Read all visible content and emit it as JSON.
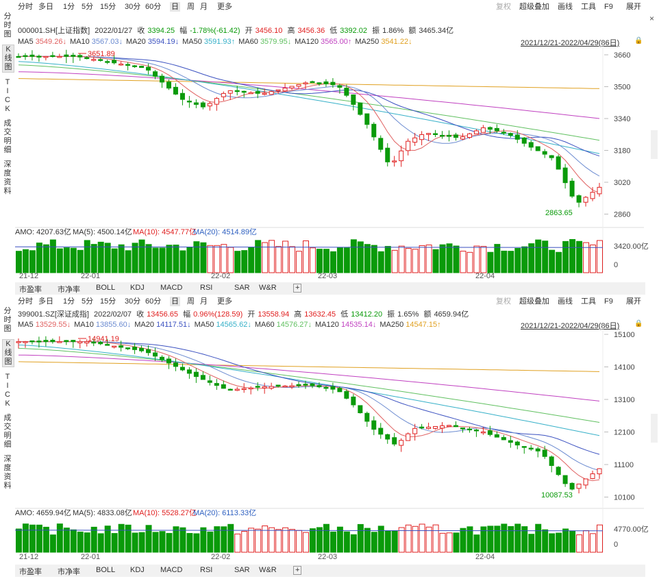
{
  "toolbar": {
    "periods": [
      "分时",
      "多日",
      "1分",
      "5分",
      "15分",
      "30分",
      "60分",
      "日",
      "周",
      "月",
      "更多"
    ],
    "active_period": "日",
    "right_items": [
      "复权",
      "超级叠加",
      "画线",
      "工具",
      "F9",
      "展开"
    ]
  },
  "side_tabs": [
    "分\n时\n图",
    "K\n线\n图",
    "T\nI\nC\nK",
    "成\n交\n明\n细",
    "深\n度\n资\n料"
  ],
  "bottom_tabs": [
    "市盈率",
    "市净率",
    "BOLL",
    "KDJ",
    "MACD",
    "RSI",
    "SAR",
    "W&R",
    "+"
  ],
  "colors": {
    "up": "#e02020",
    "down": "#0a9a0a",
    "ma5": "#e06060",
    "ma10": "#6a8ad0",
    "ma20": "#3a50c0",
    "ma50": "#36b0c8",
    "ma60": "#60c060",
    "ma120": "#c040c0",
    "ma250": "#e0a020",
    "blue": "#2d5fc0"
  },
  "panels": [
    {
      "code": "000001.SH[上证指数]",
      "date": "2022/01/27",
      "close_label": "收",
      "close": "3394.25",
      "chg_label": "幅",
      "chg": "-1.78%(-61.42)",
      "open_label": "开",
      "open": "3456.10",
      "high_label": "高",
      "high": "3456.36",
      "low_label": "低",
      "low": "3392.02",
      "amp_label": "振",
      "amp": "1.86%",
      "amt_label": "额",
      "amt": "3465.34亿",
      "ma": [
        {
          "name": "MA5",
          "value": "3549.26↓"
        },
        {
          "name": "MA10",
          "value": "3567.03↓"
        },
        {
          "name": "MA20",
          "value": "3594.19↓"
        },
        {
          "name": "MA50",
          "value": "3591.93↑"
        },
        {
          "name": "MA60",
          "value": "3579.95↓"
        },
        {
          "name": "MA120",
          "value": "3565.00↑"
        },
        {
          "name": "MA250",
          "value": "3541.22↓"
        }
      ],
      "range": "2021/12/21-2022/04/29(86日)",
      "y_ticks": [
        "3660",
        "3500",
        "3340",
        "3180",
        "3020",
        "2860"
      ],
      "high_mark": "3651.89",
      "low_mark": "2863.65",
      "amo": "AMO: 4207.63亿",
      "amo_ma5": "MA(5): 4500.14亿",
      "amo_ma10": "MA(10): 4547.77亿",
      "amo_ma20": "MA(20): 4514.89亿",
      "vol_ticks": [
        "3420.00亿",
        "0"
      ],
      "x_ticks": [
        "21-12",
        "22-01",
        "22-02",
        "22-03",
        "22-04"
      ]
    },
    {
      "code": "399001.SZ[深证成指]",
      "date": "2022/02/07",
      "close_label": "收",
      "close": "13456.65",
      "chg_label": "幅",
      "chg": "0.96%(128.59)",
      "open_label": "开",
      "open": "13558.94",
      "high_label": "高",
      "high": "13632.45",
      "low_label": "低",
      "low": "13412.20",
      "amp_label": "振",
      "amp": "1.65%",
      "amt_label": "额",
      "amt": "4659.94亿",
      "ma": [
        {
          "name": "MA5",
          "value": "13529.55↓"
        },
        {
          "name": "MA10",
          "value": "13855.60↓"
        },
        {
          "name": "MA20",
          "value": "14117.51↓"
        },
        {
          "name": "MA50",
          "value": "14565.62↓"
        },
        {
          "name": "MA60",
          "value": "14576.27↓"
        },
        {
          "name": "MA120",
          "value": "14535.14↓"
        },
        {
          "name": "MA250",
          "value": "14547.15↑"
        }
      ],
      "range": "2021/12/21-2022/04/29(86日)",
      "y_ticks": [
        "15100",
        "14100",
        "13100",
        "12100",
        "11100",
        "10100"
      ],
      "high_mark": "14941.19",
      "low_mark": "10087.53",
      "amo": "AMO: 4659.94亿",
      "amo_ma5": "MA(5): 4833.08亿",
      "amo_ma10": "MA(10): 5528.27亿",
      "amo_ma20": "MA(20): 6113.33亿",
      "vol_ticks": [
        "4770.00亿",
        "0"
      ],
      "x_ticks": [
        "21-12",
        "22-01",
        "22-02",
        "22-03",
        "22-04"
      ]
    }
  ]
}
